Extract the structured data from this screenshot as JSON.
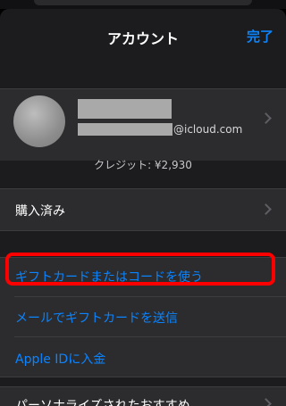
{
  "navbar": {
    "title": "アカウント",
    "done_label": "完了"
  },
  "account": {
    "email_domain": "@icloud.com"
  },
  "credit": "クレジット: ¥2,930",
  "purchased": {
    "label": "購入済み"
  },
  "links": [
    {
      "label": "ギフトカードまたはコードを使う"
    },
    {
      "label": "メールでギフトカードを送信"
    },
    {
      "label": "Apple IDに入金"
    }
  ],
  "bottom_row": {
    "label": "パーソナライズされたおすすめ"
  },
  "colors": {
    "accent": "#0a84ff",
    "highlight": "#ff0000",
    "background": "#1c1c1e"
  }
}
